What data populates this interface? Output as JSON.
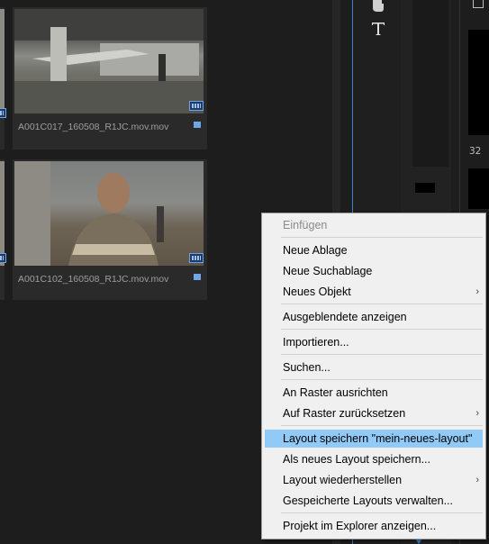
{
  "clips": [
    {
      "name": "A001C017_160508_R1JC.mov.mov"
    },
    {
      "name": "A001C102_160508_R1JC.mov.mov"
    }
  ],
  "timeline": {
    "timecode_fragment": "32"
  },
  "menu": {
    "items": [
      {
        "label": "Einfügen",
        "disabled": true
      },
      {
        "label": "Neue Ablage"
      },
      {
        "label": "Neue Suchablage"
      },
      {
        "label": "Neues Objekt",
        "submenu": true
      },
      {
        "label": "Ausgeblendete anzeigen"
      },
      {
        "label": "Importieren..."
      },
      {
        "label": "Suchen..."
      },
      {
        "label": "An Raster ausrichten"
      },
      {
        "label": "Auf Raster zurücksetzen",
        "submenu": true
      },
      {
        "label": "Layout speichern \"mein-neues-layout\"",
        "highlighted": true
      },
      {
        "label": "Als neues Layout speichern..."
      },
      {
        "label": "Layout wiederherstellen",
        "submenu": true
      },
      {
        "label": "Gespeicherte Layouts verwalten..."
      },
      {
        "label": "Projekt im Explorer anzeigen..."
      }
    ],
    "submenu_glyph": "›"
  },
  "colors": {
    "highlight": "#91c9f7",
    "accent_blue": "#3b7fd6"
  }
}
